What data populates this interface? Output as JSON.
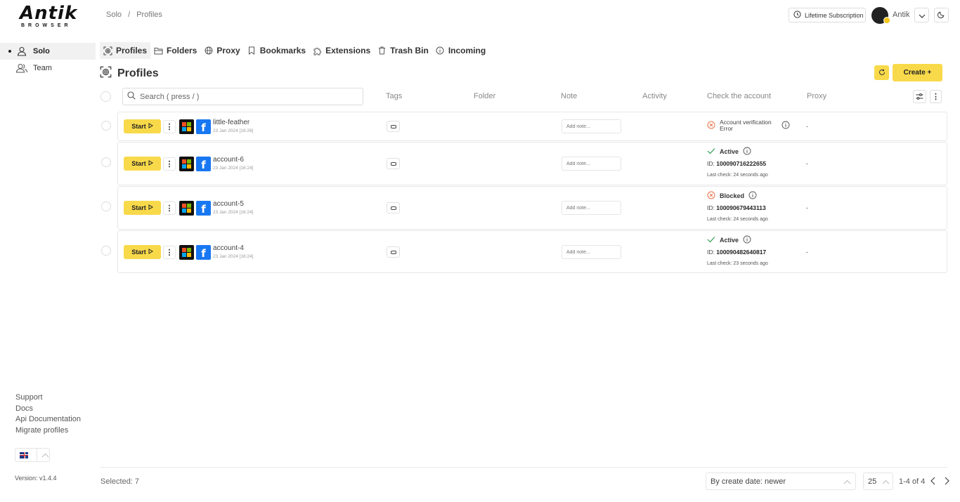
{
  "app": {
    "logo_main": "Antik",
    "logo_sub": "BROWSER"
  },
  "sidebar": {
    "items": [
      {
        "label": "Solo",
        "icon": "user-icon",
        "active": true
      },
      {
        "label": "Team",
        "icon": "users-icon",
        "active": false
      }
    ],
    "links": [
      "Support",
      "Docs",
      "Api Documentation",
      "Migrate profiles"
    ],
    "language_flag": "uk-flag-icon",
    "version": "Version: v1.4.4"
  },
  "header": {
    "breadcrumb": [
      "Solo",
      "/",
      "Profiles"
    ],
    "subscription_label": "Lifetime Subscription",
    "user_name": "Antik"
  },
  "tabs": [
    {
      "label": "Profiles",
      "icon": "fingerprint-icon",
      "active": true
    },
    {
      "label": "Folders",
      "icon": "folder-icon",
      "active": false
    },
    {
      "label": "Proxy",
      "icon": "globe-icon",
      "active": false
    },
    {
      "label": "Bookmarks",
      "icon": "bookmark-icon",
      "active": false
    },
    {
      "label": "Extensions",
      "icon": "puzzle-icon",
      "active": false
    },
    {
      "label": "Trash Bin",
      "icon": "trash-icon",
      "active": false
    },
    {
      "label": "Incoming",
      "icon": "info-icon",
      "active": false
    }
  ],
  "page": {
    "title": "Profiles",
    "create_label": "Create +"
  },
  "table": {
    "search_placeholder": "Search ( press / )",
    "columns": [
      "Tags",
      "Folder",
      "Note",
      "Activity",
      "Check the account",
      "Proxy"
    ],
    "rows": [
      {
        "start_label": "Start",
        "name": "little-feather",
        "date": "23 Jan 2024 [16:26]",
        "note_placeholder": "Add note...",
        "status": "Account verification Error",
        "status_type": "error",
        "proxy": "-"
      },
      {
        "start_label": "Start",
        "name": "account-6",
        "date": "23 Jan 2024 [16:24]",
        "note_placeholder": "Add note...",
        "status": "Active",
        "status_type": "active",
        "id_label": "ID:",
        "id": "100090716222655",
        "last_check": "Last check: 24 seconds ago",
        "proxy": "-"
      },
      {
        "start_label": "Start",
        "name": "account-5",
        "date": "23 Jan 2024 [16:24]",
        "note_placeholder": "Add note...",
        "status": "Blocked",
        "status_type": "blocked",
        "id_label": "ID:",
        "id": "100090679443113",
        "last_check": "Last check: 24 seconds ago",
        "proxy": "-"
      },
      {
        "start_label": "Start",
        "name": "account-4",
        "date": "23 Jan 2024 [16:24]",
        "note_placeholder": "Add note...",
        "status": "Active",
        "status_type": "active",
        "id_label": "ID:",
        "id": "100090482640817",
        "last_check": "Last check: 23 seconds ago",
        "proxy": "-"
      }
    ]
  },
  "footer": {
    "selected": "Selected: 7",
    "sort_value": "By create date: newer",
    "per_page": "25",
    "range": "1-4 of 4"
  },
  "colors": {
    "accent": "#f8d94a",
    "active_green": "#2e9e4f",
    "error_orange": "#e8724a",
    "facebook_blue": "#1877f2"
  }
}
